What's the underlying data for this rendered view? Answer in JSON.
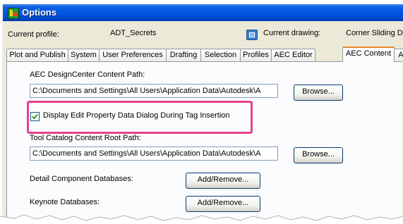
{
  "window": {
    "title": "Options",
    "colors": {
      "titlebar": "#0054e3",
      "dialog_bg": "#ece9d8",
      "active_tab_accent": "#e68b2c",
      "highlight_annotation": "#e5428f"
    }
  },
  "header": {
    "current_profile_label": "Current profile:",
    "current_profile_value": "ADT_Secrets",
    "current_drawing_label": "Current drawing:",
    "current_drawing_value": "Corner Sliding D",
    "drawing_icon": "drawing-file-icon"
  },
  "tabs": [
    {
      "label": "Plot and Publish",
      "active": false
    },
    {
      "label": "System",
      "active": false
    },
    {
      "label": "User Preferences",
      "active": false
    },
    {
      "label": "Drafting",
      "active": false
    },
    {
      "label": "Selection",
      "active": false
    },
    {
      "label": "Profiles",
      "active": false
    },
    {
      "label": "AEC Editor",
      "active": false
    },
    {
      "label": "AEC Content",
      "active": true
    },
    {
      "label": "A",
      "active": false
    }
  ],
  "aec_content": {
    "designcenter": {
      "label": "AEC DesignCenter Content Path:",
      "value": "C:\\Documents and Settings\\All Users\\Application Data\\Autodesk\\A",
      "browse_label": "Browse..."
    },
    "display_edit_property": {
      "label": "Display Edit Property Data Dialog During Tag Insertion",
      "checked": true
    },
    "tool_catalog": {
      "label": "Tool Catalog Content Root Path:",
      "value": "C:\\Documents and Settings\\All Users\\Application Data\\Autodesk\\A",
      "browse_label": "Browse..."
    },
    "detail_component": {
      "label": "Detail Component Databases:",
      "button_label": "Add/Remove..."
    },
    "keynote": {
      "label": "Keynote Databases:",
      "button_label": "Add/Remove..."
    }
  }
}
